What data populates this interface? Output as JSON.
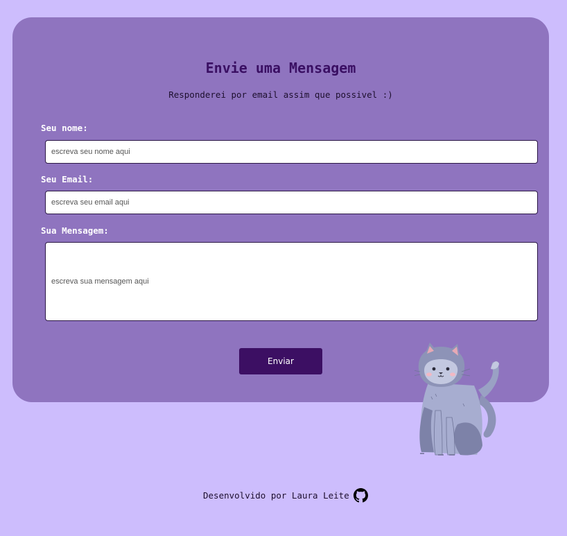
{
  "form": {
    "title": "Envie uma Mensagem",
    "subtitle": "Responderei por email assim que possivel :)",
    "name_label": "Seu nome:",
    "name_placeholder": "escreva seu nome aqui",
    "email_label": "Seu Email:",
    "email_placeholder": "escreva seu email aqui",
    "message_label": "Sua Mensagem:",
    "message_placeholder": "escreva sua mensagem aqui",
    "submit_label": "Enviar"
  },
  "footer": {
    "text": "Desenvolvido por Laura Leite",
    "icon": "github-icon"
  },
  "colors": {
    "page_background": "#cdbdfd",
    "card_background": "#8f74bf",
    "title_color": "#3a0f63",
    "button_background": "#3c0f63"
  }
}
